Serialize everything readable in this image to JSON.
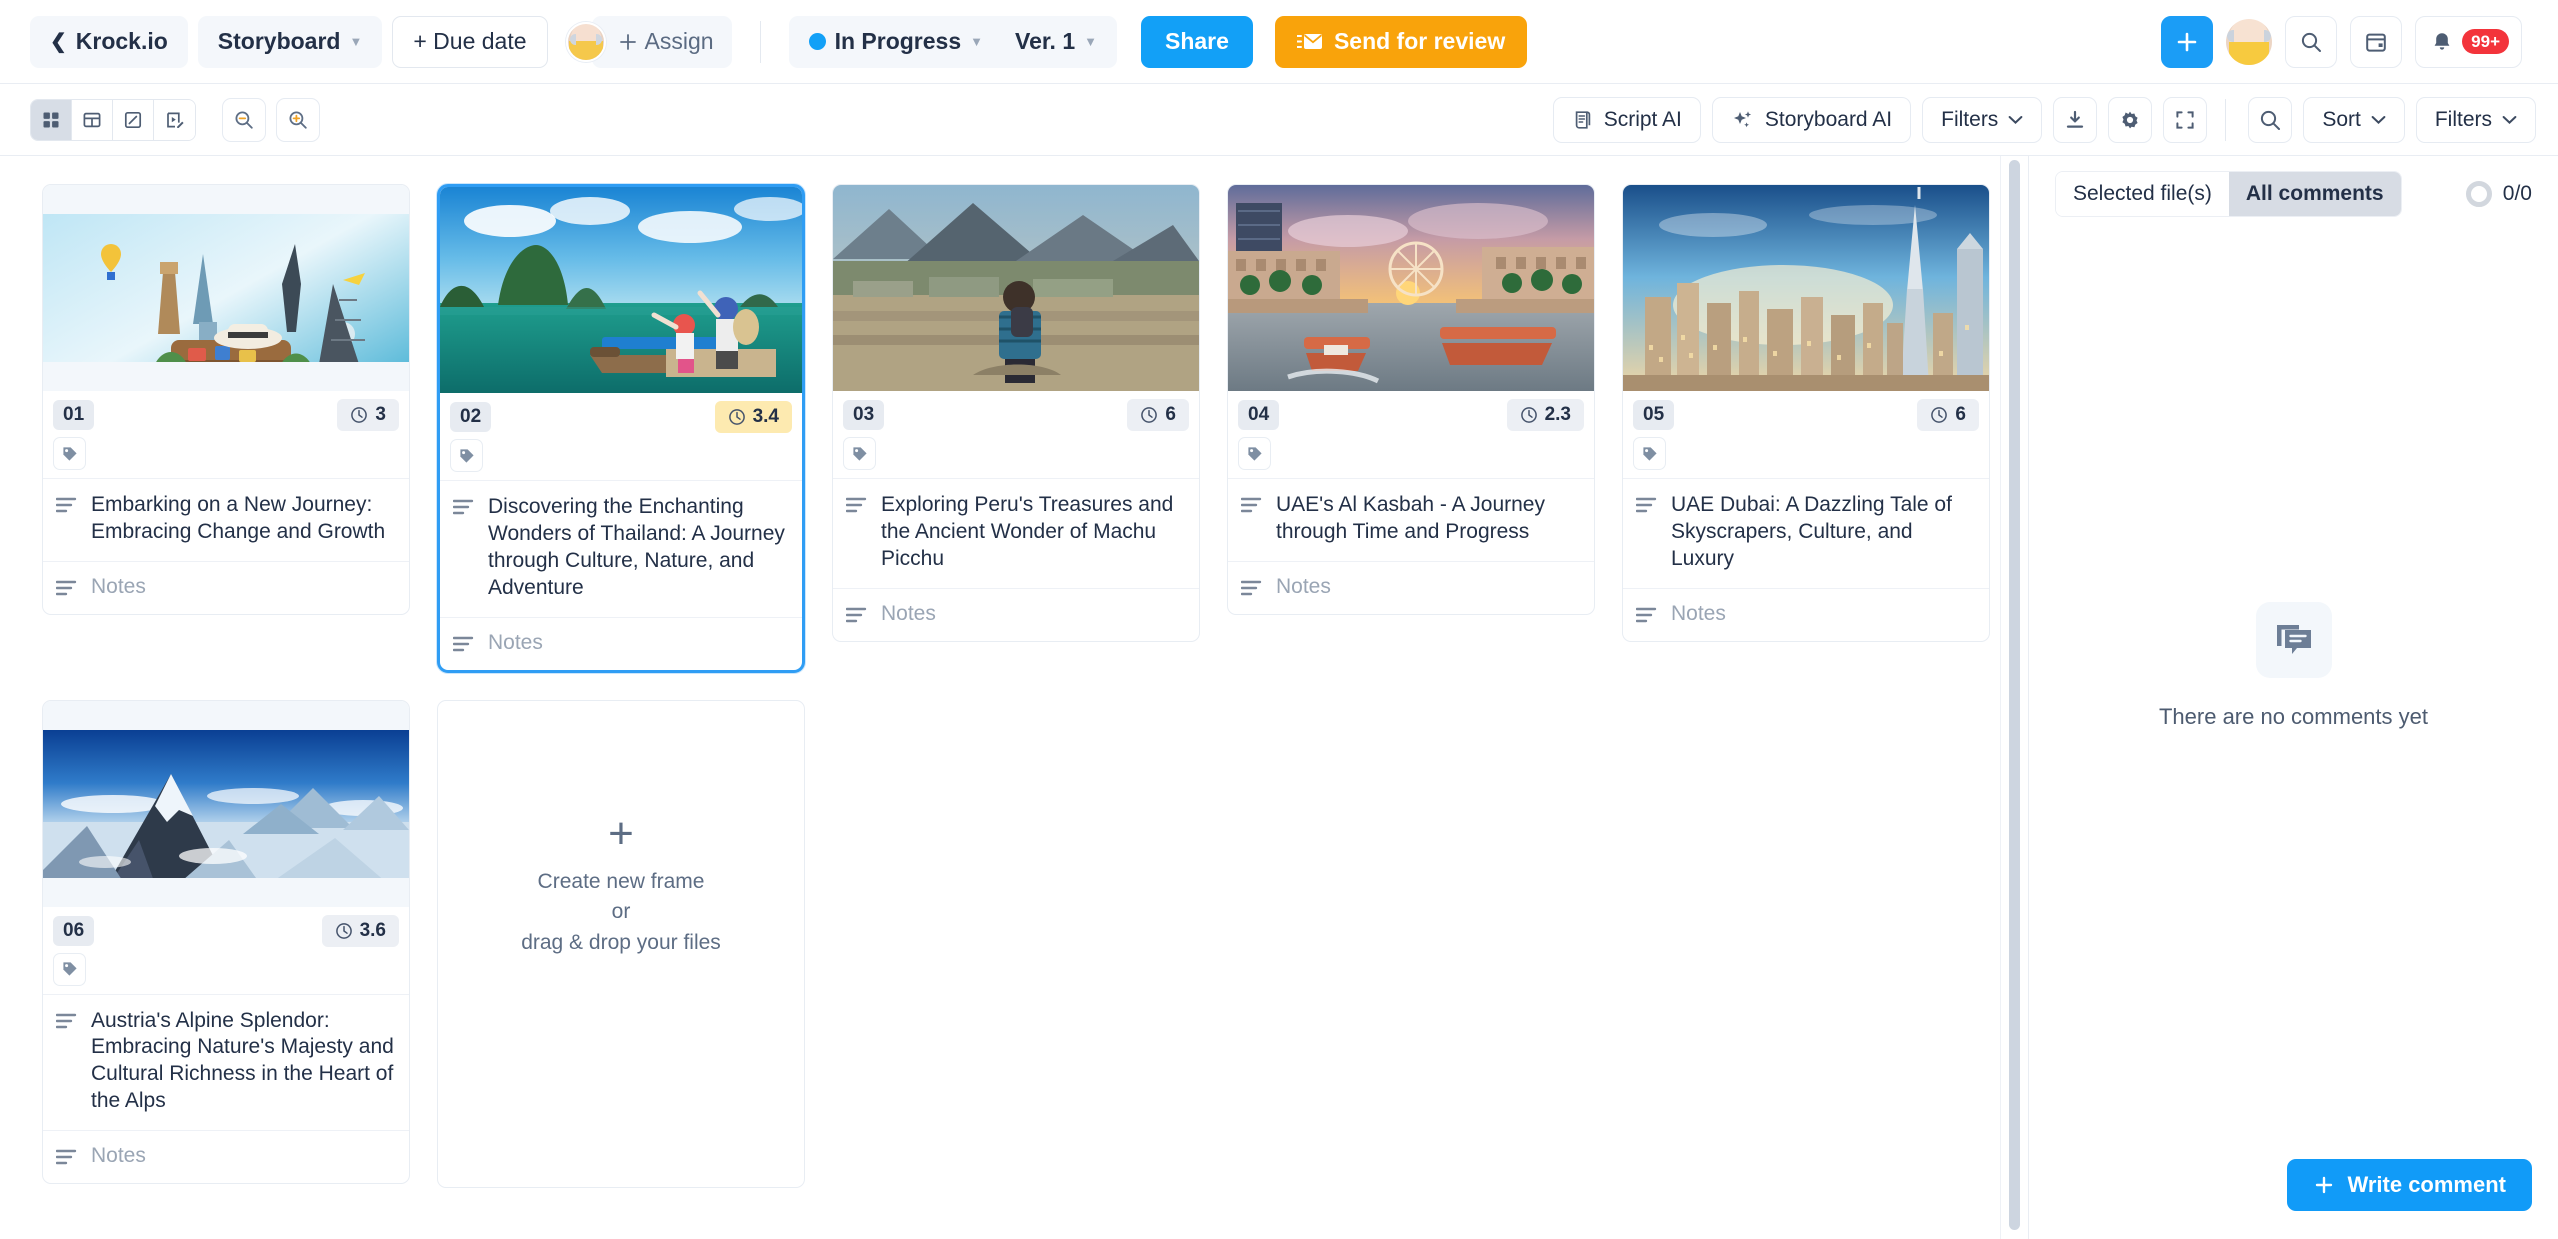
{
  "topbar": {
    "back_label": "Krock.io",
    "project_label": "Storyboard",
    "due_date_label": "+ Due date",
    "assign_label": "Assign",
    "status_label": "In Progress",
    "status_color": "#12a0f7",
    "version_label": "Ver. 1",
    "share_label": "Share",
    "send_review_label": "Send for review",
    "notification_badge": "99+",
    "accent_blue": "#12a0f7",
    "accent_orange": "#f9a30b",
    "icons": {
      "back": "chevron-left-icon",
      "add": "plus-icon",
      "search": "search-icon",
      "calendar": "calendar-icon",
      "bell": "bell-icon",
      "avatar": "avatar"
    }
  },
  "toolbar": {
    "views": [
      {
        "name": "grid-view",
        "active": true
      },
      {
        "name": "table-view",
        "active": false
      },
      {
        "name": "edit-view",
        "active": false
      },
      {
        "name": "storyboard-edit-view",
        "active": false
      }
    ],
    "zoom_out_label": "zoom-out",
    "zoom_in_label": "zoom-in",
    "script_ai_label": "Script AI",
    "storyboard_ai_label": "Storyboard AI",
    "filters_label": "Filters",
    "download_label": "download",
    "settings_label": "settings",
    "fullscreen_label": "fullscreen"
  },
  "comments_toolbar": {
    "search_label": "search",
    "sort_label": "Sort",
    "filters_label": "Filters"
  },
  "comments_panel": {
    "tab_selected_files": "Selected file(s)",
    "tab_all_comments": "All comments",
    "active_tab": "All comments",
    "counter": "0/0",
    "empty_message": "There are no comments yet",
    "write_comment_label": "Write comment"
  },
  "frames": [
    {
      "number": "01",
      "duration": "3",
      "duration_highlight": false,
      "title": "Embarking on a New Journey: Embracing Change and Growth",
      "notes_placeholder": "Notes",
      "selected": false,
      "thumb": "travel-landmarks-collage",
      "letterbox": true
    },
    {
      "number": "02",
      "duration": "3.4",
      "duration_highlight": true,
      "title": "Discovering the Enchanting Wonders of Thailand: A Journey through Culture, Nature, and Adventure",
      "notes_placeholder": "Notes",
      "selected": true,
      "thumb": "thailand-bay-travelers",
      "letterbox": false
    },
    {
      "number": "03",
      "duration": "6",
      "duration_highlight": false,
      "title": "Exploring Peru's Treasures and the Ancient Wonder of Machu Picchu",
      "notes_placeholder": "Notes",
      "selected": false,
      "thumb": "machu-picchu-traveler",
      "letterbox": false
    },
    {
      "number": "04",
      "duration": "2.3",
      "duration_highlight": false,
      "title": "UAE's Al Kasbah - A Journey through Time and Progress",
      "notes_placeholder": "Notes",
      "selected": false,
      "thumb": "al-kasbah-canal-sunset",
      "letterbox": false
    },
    {
      "number": "05",
      "duration": "6",
      "duration_highlight": false,
      "title": "UAE Dubai: A Dazzling Tale of Skyscrapers, Culture, and Luxury",
      "notes_placeholder": "Notes",
      "selected": false,
      "thumb": "dubai-skyline",
      "letterbox": false
    },
    {
      "number": "06",
      "duration": "3.6",
      "duration_highlight": false,
      "title": "Austria's Alpine Splendor: Embracing Nature's Majesty and Cultural Richness in the Heart of the Alps",
      "notes_placeholder": "Notes",
      "selected": false,
      "thumb": "alpine-snow-mountains",
      "letterbox": true
    }
  ],
  "dropzone": {
    "plus": "+",
    "line1": "Create new frame",
    "line2": "or",
    "line3": "drag & drop your files"
  }
}
